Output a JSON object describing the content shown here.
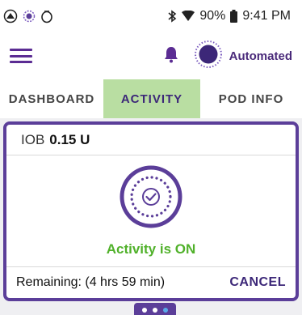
{
  "status_bar": {
    "battery": "90%",
    "time": "9:41 PM",
    "icons": [
      "omnipod-icon",
      "pod-status-icon",
      "circle-icon",
      "bluetooth-icon",
      "wifi-icon",
      "battery-icon"
    ]
  },
  "app_bar": {
    "mode_label": "Automated",
    "icons": [
      "menu-icon",
      "bell-icon",
      "automated-mode-icon"
    ]
  },
  "tabs": [
    {
      "label": "DASHBOARD",
      "active": false
    },
    {
      "label": "ACTIVITY",
      "active": true
    },
    {
      "label": "POD INFO",
      "active": false
    }
  ],
  "card": {
    "iob_label": "IOB",
    "iob_value": "0.15 U",
    "status": "Activity is ON",
    "remaining": "Remaining: (4 hrs 59 min)",
    "cancel_label": "CANCEL"
  },
  "pager": {
    "count": 3,
    "active_index": 2
  },
  "colors": {
    "brand_purple": "#5b3e99",
    "active_tab": "#b9dea2",
    "status_green": "#50b12a"
  }
}
